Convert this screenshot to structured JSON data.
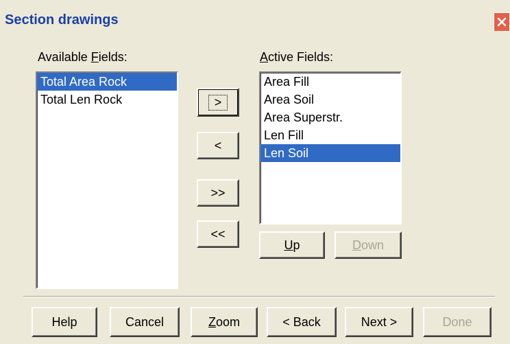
{
  "window": {
    "title": "Section drawings",
    "close_icon": "close-icon"
  },
  "available": {
    "label_pre": "Available ",
    "label_key": "F",
    "label_post": "ields:",
    "items": [
      "Total Area Rock",
      "Total Len Rock"
    ],
    "selected_index": 0
  },
  "active": {
    "label_key": "A",
    "label_post": "ctive Fields:",
    "items": [
      "Area Fill",
      "Area Soil",
      "Area Superstr.",
      "Len Fill",
      "Len Soil"
    ],
    "selected_index": 4
  },
  "transfer": {
    "add": ">",
    "remove": "<",
    "add_all": ">>",
    "remove_all": "<<"
  },
  "order": {
    "up_key": "U",
    "up_rest": "p",
    "down_key": "D",
    "down_rest": "own"
  },
  "footer": {
    "help": "Help",
    "cancel": "Cancel",
    "zoom_key": "Z",
    "zoom_rest": "oom",
    "back": "< Back",
    "next": "Next >",
    "done": "Done"
  },
  "colors": {
    "selection": "#316ac5",
    "dialog_bg": "#ece9d8",
    "title_text": "#1a3fa8",
    "close_bg": "#e2614b"
  }
}
